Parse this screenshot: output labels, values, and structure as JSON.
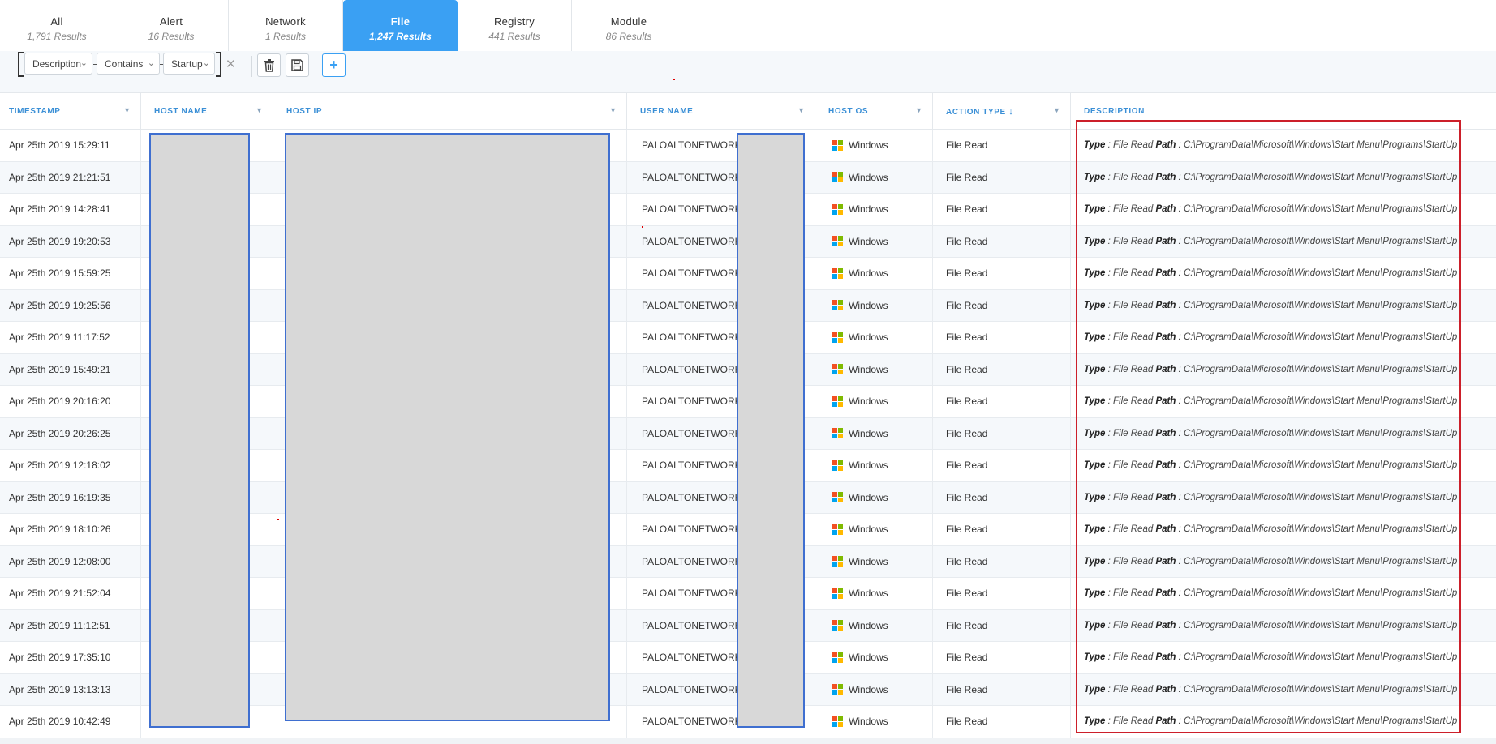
{
  "tabs": [
    {
      "name": "All",
      "count": "1,791 Results"
    },
    {
      "name": "Alert",
      "count": "16 Results"
    },
    {
      "name": "Network",
      "count": "1 Results"
    },
    {
      "name": "File",
      "count": "1,247 Results"
    },
    {
      "name": "Registry",
      "count": "441 Results"
    },
    {
      "name": "Module",
      "count": "86 Results"
    }
  ],
  "active_tab": "File",
  "filter": {
    "field": "Description",
    "operator": "Contains",
    "value": "Startup"
  },
  "columns": {
    "timestamp": "TIMESTAMP",
    "host_name": "HOST NAME",
    "host_ip": "HOST IP",
    "user_name": "USER NAME",
    "host_os": "HOST OS",
    "action_type": "ACTION TYPE",
    "description": "DESCRIPTION"
  },
  "rows": [
    {
      "timestamp": "Apr 25th 2019 15:29:11",
      "user": "PALOALTONETWORK",
      "os": "Windows",
      "action": "File Read",
      "type_label": "Type",
      "type_val": "File Read",
      "path_label": "Path",
      "path_val": "C:\\ProgramData\\Microsoft\\Windows\\Start Menu\\Programs\\StartUp"
    },
    {
      "timestamp": "Apr 25th 2019 21:21:51",
      "user": "PALOALTONETWORK",
      "os": "Windows",
      "action": "File Read",
      "type_label": "Type",
      "type_val": "File Read",
      "path_label": "Path",
      "path_val": "C:\\ProgramData\\Microsoft\\Windows\\Start Menu\\Programs\\StartUp"
    },
    {
      "timestamp": "Apr 25th 2019 14:28:41",
      "user": "PALOALTONETWORK",
      "os": "Windows",
      "action": "File Read",
      "type_label": "Type",
      "type_val": "File Read",
      "path_label": "Path",
      "path_val": "C:\\ProgramData\\Microsoft\\Windows\\Start Menu\\Programs\\StartUp"
    },
    {
      "timestamp": "Apr 25th 2019 19:20:53",
      "user": "PALOALTONETWORK",
      "os": "Windows",
      "action": "File Read",
      "type_label": "Type",
      "type_val": "File Read",
      "path_label": "Path",
      "path_val": "C:\\ProgramData\\Microsoft\\Windows\\Start Menu\\Programs\\StartUp"
    },
    {
      "timestamp": "Apr 25th 2019 15:59:25",
      "user": "PALOALTONETWORK",
      "os": "Windows",
      "action": "File Read",
      "type_label": "Type",
      "type_val": "File Read",
      "path_label": "Path",
      "path_val": "C:\\ProgramData\\Microsoft\\Windows\\Start Menu\\Programs\\StartUp"
    },
    {
      "timestamp": "Apr 25th 2019 19:25:56",
      "user": "PALOALTONETWORK",
      "os": "Windows",
      "action": "File Read",
      "type_label": "Type",
      "type_val": "File Read",
      "path_label": "Path",
      "path_val": "C:\\ProgramData\\Microsoft\\Windows\\Start Menu\\Programs\\StartUp"
    },
    {
      "timestamp": "Apr 25th 2019 11:17:52",
      "user": "PALOALTONETWORK",
      "os": "Windows",
      "action": "File Read",
      "type_label": "Type",
      "type_val": "File Read",
      "path_label": "Path",
      "path_val": "C:\\ProgramData\\Microsoft\\Windows\\Start Menu\\Programs\\StartUp"
    },
    {
      "timestamp": "Apr 25th 2019 15:49:21",
      "user": "PALOALTONETWORK",
      "os": "Windows",
      "action": "File Read",
      "type_label": "Type",
      "type_val": "File Read",
      "path_label": "Path",
      "path_val": "C:\\ProgramData\\Microsoft\\Windows\\Start Menu\\Programs\\StartUp"
    },
    {
      "timestamp": "Apr 25th 2019 20:16:20",
      "user": "PALOALTONETWORK",
      "os": "Windows",
      "action": "File Read",
      "type_label": "Type",
      "type_val": "File Read",
      "path_label": "Path",
      "path_val": "C:\\ProgramData\\Microsoft\\Windows\\Start Menu\\Programs\\StartUp"
    },
    {
      "timestamp": "Apr 25th 2019 20:26:25",
      "user": "PALOALTONETWORK",
      "os": "Windows",
      "action": "File Read",
      "type_label": "Type",
      "type_val": "File Read",
      "path_label": "Path",
      "path_val": "C:\\ProgramData\\Microsoft\\Windows\\Start Menu\\Programs\\StartUp"
    },
    {
      "timestamp": "Apr 25th 2019 12:18:02",
      "user": "PALOALTONETWORK",
      "os": "Windows",
      "action": "File Read",
      "type_label": "Type",
      "type_val": "File Read",
      "path_label": "Path",
      "path_val": "C:\\ProgramData\\Microsoft\\Windows\\Start Menu\\Programs\\StartUp"
    },
    {
      "timestamp": "Apr 25th 2019 16:19:35",
      "user": "PALOALTONETWORK",
      "os": "Windows",
      "action": "File Read",
      "type_label": "Type",
      "type_val": "File Read",
      "path_label": "Path",
      "path_val": "C:\\ProgramData\\Microsoft\\Windows\\Start Menu\\Programs\\StartUp"
    },
    {
      "timestamp": "Apr 25th 2019 18:10:26",
      "user": "PALOALTONETWORK",
      "os": "Windows",
      "action": "File Read",
      "type_label": "Type",
      "type_val": "File Read",
      "path_label": "Path",
      "path_val": "C:\\ProgramData\\Microsoft\\Windows\\Start Menu\\Programs\\StartUp"
    },
    {
      "timestamp": "Apr 25th 2019 12:08:00",
      "user": "PALOALTONETWORK",
      "os": "Windows",
      "action": "File Read",
      "type_label": "Type",
      "type_val": "File Read",
      "path_label": "Path",
      "path_val": "C:\\ProgramData\\Microsoft\\Windows\\Start Menu\\Programs\\StartUp"
    },
    {
      "timestamp": "Apr 25th 2019 21:52:04",
      "user": "PALOALTONETWORK",
      "os": "Windows",
      "action": "File Read",
      "type_label": "Type",
      "type_val": "File Read",
      "path_label": "Path",
      "path_val": "C:\\ProgramData\\Microsoft\\Windows\\Start Menu\\Programs\\StartUp"
    },
    {
      "timestamp": "Apr 25th 2019 11:12:51",
      "user": "PALOALTONETWORK",
      "os": "Windows",
      "action": "File Read",
      "type_label": "Type",
      "type_val": "File Read",
      "path_label": "Path",
      "path_val": "C:\\ProgramData\\Microsoft\\Windows\\Start Menu\\Programs\\StartUp"
    },
    {
      "timestamp": "Apr 25th 2019 17:35:10",
      "user": "PALOALTONETWORK",
      "os": "Windows",
      "action": "File Read",
      "type_label": "Type",
      "type_val": "File Read",
      "path_label": "Path",
      "path_val": "C:\\ProgramData\\Microsoft\\Windows\\Start Menu\\Programs\\StartUp"
    },
    {
      "timestamp": "Apr 25th 2019 13:13:13",
      "user": "PALOALTONETWORK",
      "os": "Windows",
      "action": "File Read",
      "type_label": "Type",
      "type_val": "File Read",
      "path_label": "Path",
      "path_val": "C:\\ProgramData\\Microsoft\\Windows\\Start Menu\\Programs\\StartUp"
    },
    {
      "timestamp": "Apr 25th 2019 10:42:49",
      "user": "PALOALTONETWORK",
      "os": "Windows",
      "action": "File Read",
      "type_label": "Type",
      "type_val": "File Read",
      "path_label": "Path",
      "path_val": "C:\\ProgramData\\Microsoft\\Windows\\Start Menu\\Programs\\StartUp"
    }
  ],
  "colors": {
    "accent": "#3aa0f3",
    "header_text": "#3a8fd6",
    "redaction_fill": "#d8d8d8",
    "redaction_border": "#3f6fd0",
    "annotation_border": "#cc1f2a"
  },
  "icons": {
    "delete": "trash-icon",
    "save": "save-icon",
    "add": "plus-icon",
    "clear": "close-icon",
    "filter": "filter-icon",
    "os": "windows-logo-icon"
  }
}
